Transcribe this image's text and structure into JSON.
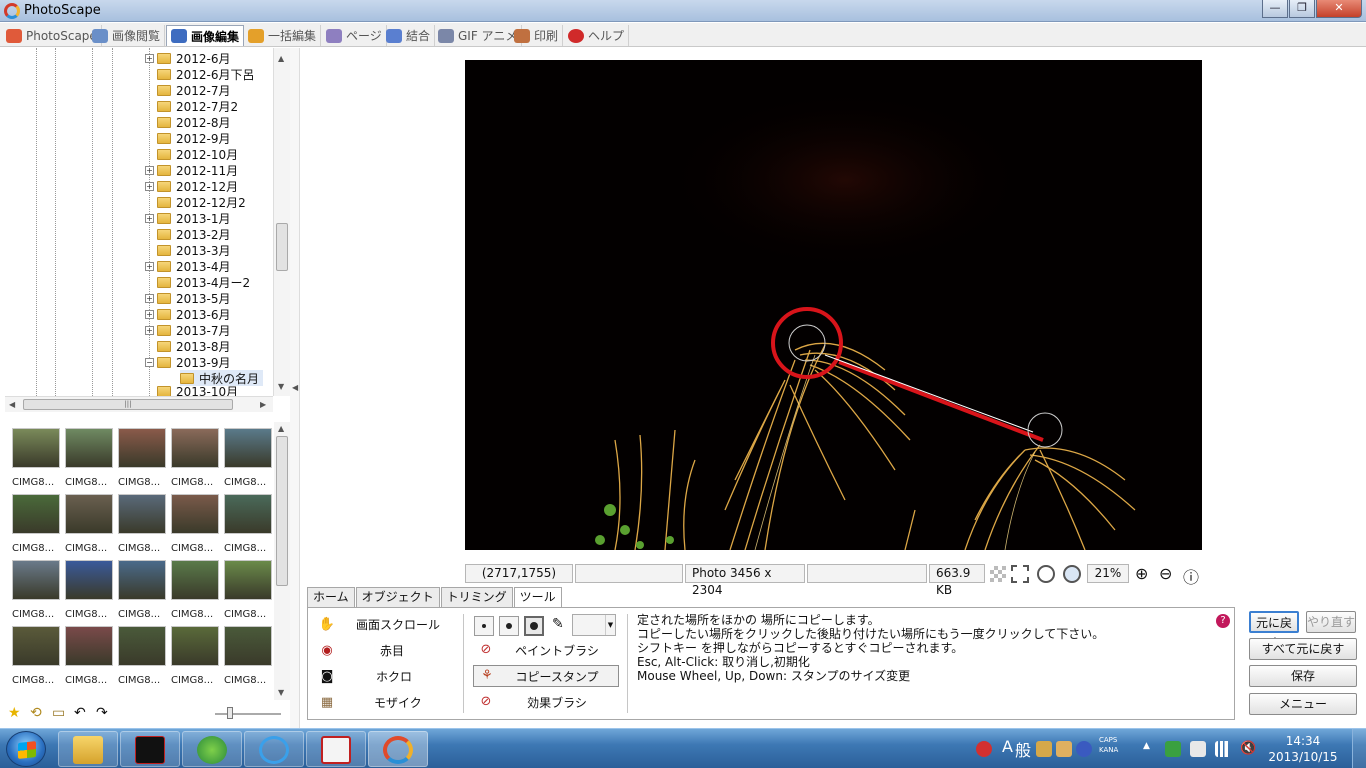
{
  "window": {
    "title": "PhotoScape",
    "controls": {
      "minimize": "—",
      "maximize": "❐",
      "close": "✕"
    }
  },
  "menu_tabs": [
    {
      "label": "PhotoScape",
      "icon": "photoscape-icon",
      "color": "#e05a3a"
    },
    {
      "label": "画像閲覧",
      "icon": "viewer-icon",
      "color": "#6a8fc8"
    },
    {
      "label": "画像編集",
      "icon": "editor-icon",
      "color": "#3e6cc0",
      "active": true
    },
    {
      "label": "一括編集",
      "icon": "batch-icon",
      "color": "#e4a02a"
    },
    {
      "label": "ページ",
      "icon": "page-icon",
      "color": "#8e7fc0"
    },
    {
      "label": "結合",
      "icon": "combine-icon",
      "color": "#5a7fd0"
    },
    {
      "label": "GIF アニメ",
      "icon": "gif-icon",
      "color": "#7b87a8"
    },
    {
      "label": "印刷",
      "icon": "print-icon",
      "color": "#c07040"
    },
    {
      "label": "ヘルプ",
      "icon": "help-icon",
      "color": "#d02a2a"
    }
  ],
  "folder_tree": [
    {
      "label": "2012-6月",
      "expandable": true
    },
    {
      "label": "2012-6月下呂",
      "expandable": false
    },
    {
      "label": "2012-7月",
      "expandable": false
    },
    {
      "label": "2012-7月2",
      "expandable": false
    },
    {
      "label": "2012-8月",
      "expandable": false
    },
    {
      "label": "2012-9月",
      "expandable": false
    },
    {
      "label": "2012-10月",
      "expandable": false
    },
    {
      "label": "2012-11月",
      "expandable": true
    },
    {
      "label": "2012-12月",
      "expandable": true
    },
    {
      "label": "2012-12月2",
      "expandable": false
    },
    {
      "label": "2013-1月",
      "expandable": true
    },
    {
      "label": "2013-2月",
      "expandable": false
    },
    {
      "label": "2013-3月",
      "expandable": false
    },
    {
      "label": "2013-4月",
      "expandable": true
    },
    {
      "label": "2013-4月ー2",
      "expandable": false
    },
    {
      "label": "2013-5月",
      "expandable": true
    },
    {
      "label": "2013-6月",
      "expandable": true
    },
    {
      "label": "2013-7月",
      "expandable": true
    },
    {
      "label": "2013-8月",
      "expandable": false
    },
    {
      "label": "2013-9月",
      "expandable": true,
      "expanded": true
    },
    {
      "label": "中秋の名月",
      "child": true,
      "selected": true
    },
    {
      "label": "2013-10月",
      "expandable": false
    }
  ],
  "thumbnails": {
    "label": "CIMG8...",
    "colors": [
      "#7a8a5a",
      "#6f8a62",
      "#8a5a4a",
      "#8a6a5a",
      "#5a7a8a",
      "#4a6a3a",
      "#6a6050",
      "#5a6a7a",
      "#7a5a4a",
      "#4a6a5a",
      "#6a7a8a",
      "#3a5a9a",
      "#4a6a8a",
      "#5a7a4a",
      "#6a8a4a",
      "#5a5a3a",
      "#7a4a4a",
      "#4a5a3a",
      "#5a6a3a",
      "#4a5a3a"
    ]
  },
  "thumb_toolbar": {
    "icons": [
      "star-icon",
      "rotate-icon",
      "folder-open-icon",
      "back-icon",
      "forward-icon"
    ]
  },
  "status": {
    "coords": "(2717,1755)",
    "photo_info": "Photo 3456 x 2304",
    "file_size": "663.9 KB",
    "zoom": "21%"
  },
  "tool_tabs": [
    {
      "label": "ホーム"
    },
    {
      "label": "オブジェクト"
    },
    {
      "label": "トリミング"
    },
    {
      "label": "ツール",
      "active": true
    }
  ],
  "tools": [
    {
      "label": "画面スクロール",
      "icon": "hand-icon"
    },
    {
      "label": "赤目",
      "icon": "redeye-icon"
    },
    {
      "label": "ホクロ",
      "icon": "mole-icon"
    },
    {
      "label": "モザイク",
      "icon": "mosaic-icon"
    }
  ],
  "sub_tools": [
    {
      "label": "ペイントブラシ",
      "icon": "paintbrush-icon"
    },
    {
      "label": "コピースタンプ",
      "icon": "clone-stamp-icon",
      "selected": true
    },
    {
      "label": "効果ブラシ",
      "icon": "effect-brush-icon"
    }
  ],
  "help_lines": [
    "定された場所をほかの 場所にコピーします。",
    "コピーしたい場所をクリックした後貼り付けたい場所にもう一度クリックして下さい。",
    "シフトキー を押しながらコピーするとすぐコピーされます。",
    "Esc, Alt-Click: 取り消し,初期化",
    "Mouse Wheel, Up, Down: スタンプのサイズ変更"
  ],
  "right_buttons": {
    "undo": "元に戻す",
    "redo": "やり直す",
    "undo_all": "すべて元に戻す",
    "save": "保存",
    "menu": "メニュー"
  },
  "taskbar": {
    "ime_a": "A",
    "ime_mode": "般",
    "caps": "CAPS",
    "kana": "KANA",
    "time": "14:34",
    "date": "2013/10/15"
  },
  "colors": {
    "annotation_red": "#d8141a",
    "photo_bg": "#030000",
    "grass": "#e8b04a"
  }
}
